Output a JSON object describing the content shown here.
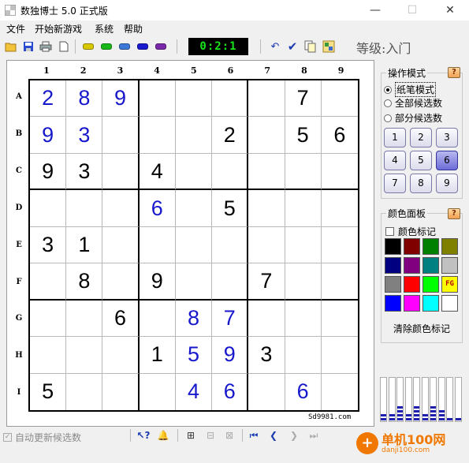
{
  "window": {
    "title": "数独博士 5.0 正式版",
    "minimize": "—",
    "maximize": "☐",
    "close": "✕"
  },
  "menu": [
    "文件",
    "开始新游戏",
    "系统",
    "帮助"
  ],
  "toolbar": {
    "timer": "0:2:1",
    "level": "等级:入门",
    "pill_colors": [
      "#d8c800",
      "#18b818",
      "#3c78d8",
      "#1a1ad0",
      "#7a2aa8"
    ]
  },
  "board": {
    "col_labels": [
      "1",
      "2",
      "3",
      "4",
      "5",
      "6",
      "7",
      "8",
      "9"
    ],
    "row_labels": [
      "A",
      "B",
      "C",
      "D",
      "E",
      "F",
      "G",
      "H",
      "I"
    ],
    "cells": [
      [
        {
          "v": "2",
          "t": "u"
        },
        {
          "v": "8",
          "t": "u"
        },
        {
          "v": "9",
          "t": "u"
        },
        {
          "v": "",
          "t": ""
        },
        {
          "v": "",
          "t": ""
        },
        {
          "v": "",
          "t": ""
        },
        {
          "v": "",
          "t": ""
        },
        {
          "v": "7",
          "t": "g"
        },
        {
          "v": "",
          "t": ""
        }
      ],
      [
        {
          "v": "9",
          "t": "u"
        },
        {
          "v": "3",
          "t": "u"
        },
        {
          "v": "",
          "t": ""
        },
        {
          "v": "",
          "t": ""
        },
        {
          "v": "",
          "t": ""
        },
        {
          "v": "2",
          "t": "g"
        },
        {
          "v": "",
          "t": ""
        },
        {
          "v": "5",
          "t": "g"
        },
        {
          "v": "6",
          "t": "g"
        }
      ],
      [
        {
          "v": "9",
          "t": "g"
        },
        {
          "v": "3",
          "t": "g"
        },
        {
          "v": "",
          "t": ""
        },
        {
          "v": "4",
          "t": "g"
        },
        {
          "v": "",
          "t": ""
        },
        {
          "v": "",
          "t": ""
        },
        {
          "v": "",
          "t": ""
        },
        {
          "v": "",
          "t": ""
        },
        {
          "v": "",
          "t": ""
        }
      ],
      [
        {
          "v": "",
          "t": ""
        },
        {
          "v": "",
          "t": ""
        },
        {
          "v": "",
          "t": ""
        },
        {
          "v": "6",
          "t": "u"
        },
        {
          "v": "",
          "t": ""
        },
        {
          "v": "5",
          "t": "g"
        },
        {
          "v": "",
          "t": ""
        },
        {
          "v": "",
          "t": ""
        },
        {
          "v": "",
          "t": ""
        }
      ],
      [
        {
          "v": "3",
          "t": "g"
        },
        {
          "v": "1",
          "t": "g"
        },
        {
          "v": "",
          "t": ""
        },
        {
          "v": "",
          "t": ""
        },
        {
          "v": "",
          "t": ""
        },
        {
          "v": "",
          "t": ""
        },
        {
          "v": "",
          "t": ""
        },
        {
          "v": "",
          "t": ""
        },
        {
          "v": "",
          "t": ""
        }
      ],
      [
        {
          "v": "",
          "t": ""
        },
        {
          "v": "8",
          "t": "g"
        },
        {
          "v": "",
          "t": ""
        },
        {
          "v": "9",
          "t": "g"
        },
        {
          "v": "",
          "t": ""
        },
        {
          "v": "",
          "t": ""
        },
        {
          "v": "7",
          "t": "g"
        },
        {
          "v": "",
          "t": ""
        },
        {
          "v": "",
          "t": ""
        }
      ],
      [
        {
          "v": "",
          "t": ""
        },
        {
          "v": "",
          "t": ""
        },
        {
          "v": "6",
          "t": "g"
        },
        {
          "v": "",
          "t": ""
        },
        {
          "v": "8",
          "t": "u"
        },
        {
          "v": "7",
          "t": "u"
        },
        {
          "v": "",
          "t": ""
        },
        {
          "v": "",
          "t": ""
        },
        {
          "v": "",
          "t": ""
        }
      ],
      [
        {
          "v": "",
          "t": ""
        },
        {
          "v": "",
          "t": ""
        },
        {
          "v": "",
          "t": ""
        },
        {
          "v": "1",
          "t": "g"
        },
        {
          "v": "5",
          "t": "u"
        },
        {
          "v": "9",
          "t": "u"
        },
        {
          "v": "3",
          "t": "g"
        },
        {
          "v": "",
          "t": ""
        },
        {
          "v": "",
          "t": ""
        }
      ],
      [
        {
          "v": "5",
          "t": "g"
        },
        {
          "v": "",
          "t": ""
        },
        {
          "v": "",
          "t": ""
        },
        {
          "v": "",
          "t": ""
        },
        {
          "v": "4",
          "t": "u"
        },
        {
          "v": "6",
          "t": "u"
        },
        {
          "v": "",
          "t": ""
        },
        {
          "v": "6",
          "t": "u"
        },
        {
          "v": "",
          "t": ""
        }
      ]
    ],
    "site": "Sd9981.com"
  },
  "mode_panel": {
    "title": "操作模式",
    "help": "?",
    "options": [
      "纸笔模式",
      "全部候选数",
      "部分候选数"
    ],
    "selected_option": 0,
    "numbers": [
      "1",
      "2",
      "3",
      "4",
      "5",
      "6",
      "7",
      "8",
      "9"
    ],
    "active_number": "6"
  },
  "color_panel": {
    "title": "颜色面板",
    "help": "?",
    "checkbox_label": "颜色标记",
    "checked": false,
    "swatches": [
      "#000000",
      "#800000",
      "#008000",
      "#808000",
      "#000080",
      "#800080",
      "#008080",
      "#c0c0c0",
      "#808080",
      "#ff0000",
      "#00ff00",
      "#ffff00",
      "#0000ff",
      "#ff00ff",
      "#00ffff",
      "#ffffff"
    ],
    "fg_label": "FG",
    "clear_label": "清除颜色标记"
  },
  "meters": [
    2,
    2,
    4,
    2,
    4,
    2,
    4,
    3,
    1,
    1
  ],
  "bottom": {
    "auto_update_label": "自动更新候选数",
    "auto_update_checked": true
  },
  "watermark": {
    "main": "单机100网",
    "sub": "danji100.com"
  }
}
